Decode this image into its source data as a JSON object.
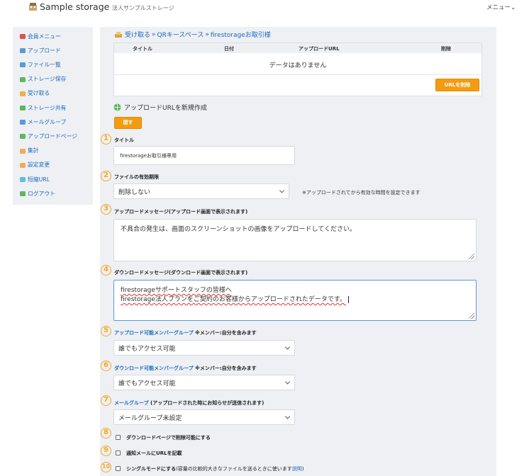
{
  "header": {
    "logo_text": "Sample storage",
    "tagline": "法人サンプルストレージ",
    "menu_label": "メニュー"
  },
  "sidebar": {
    "items": [
      {
        "label": "会員メニュー",
        "icon": "member-icon"
      },
      {
        "label": "アップロード",
        "icon": "upload-icon"
      },
      {
        "label": "ファイル一覧",
        "icon": "file-list-icon"
      },
      {
        "label": "ストレージ保存",
        "icon": "storage-save-icon"
      },
      {
        "label": "受け取る",
        "icon": "receive-icon"
      },
      {
        "label": "ストレージ共有",
        "icon": "storage-share-icon"
      },
      {
        "label": "メールグループ",
        "icon": "mail-group-icon"
      },
      {
        "label": "アップロードページ",
        "icon": "upload-page-icon"
      },
      {
        "label": "集計",
        "icon": "stats-icon"
      },
      {
        "label": "設定変更",
        "icon": "settings-icon"
      },
      {
        "label": "短縮URL",
        "icon": "short-url-icon"
      },
      {
        "label": "ログアウト",
        "icon": "logout-icon"
      }
    ]
  },
  "breadcrumb": {
    "items": [
      "受け取る",
      "QRキースペース",
      "firestorageお取引様"
    ],
    "separator": "»"
  },
  "url_table": {
    "columns": [
      "タイトル",
      "日付",
      "アップロードURL",
      "削除"
    ],
    "empty_text": "データはありません",
    "delete_button": "URLを削除"
  },
  "new_url": {
    "label": "アップロードURLを新規作成",
    "close_button": "閉す"
  },
  "form": {
    "f1": {
      "number": "1",
      "label": "タイトル",
      "value": "firestorageお取引様専用"
    },
    "f2": {
      "number": "2",
      "label": "ファイルの有効期限",
      "value": "削除しない",
      "note": "※アップロードされてから有効な時間を設定できます"
    },
    "f3": {
      "number": "3",
      "label": "アップロードメッセージ(アップロード画面で表示されます)",
      "value": "不具合の発生は、画面のスクリーンショットの画像をアップロードしてください。"
    },
    "f4": {
      "number": "4",
      "label": "ダウンロードメッセージ(ダウンロード画面で表示されます)",
      "line1": "firestorageサポートスタッフの皆様へ",
      "line2": "firestorage法人プランをご契約のお客様からアップロードされたデータです。"
    },
    "f5": {
      "number": "5",
      "label_link": "アップロード可能メンバーグループ",
      "label_suffix": " ※メンバー:自分を含みます",
      "value": "誰でもアクセス可能"
    },
    "f6": {
      "number": "6",
      "label_link": "ダウンロード可能メンバーグループ",
      "label_suffix": " ※メンバー:自分を含みます",
      "value": "誰でもアクセス可能"
    },
    "f7": {
      "number": "7",
      "label_link": "メールグループ",
      "label_suffix": " (アップロードされた時にお知らせが送信されます)",
      "value": "メールグループ未設定"
    },
    "f8": {
      "number": "8",
      "label": "ダウンロードページで削除可能にする",
      "checked": false
    },
    "f9": {
      "number": "9",
      "label": "通知メールにURLを記載",
      "checked": false
    },
    "f10": {
      "number": "10",
      "label": "シングルモードにする",
      "label_note": "(容量の比較的大きなファイルを送るときに使います",
      "link": "説明",
      "close_paren": ")",
      "checked": false
    }
  },
  "colors": {
    "accent": "#f39c12",
    "link": "#1a66c2",
    "panel": "#eef0f3"
  }
}
